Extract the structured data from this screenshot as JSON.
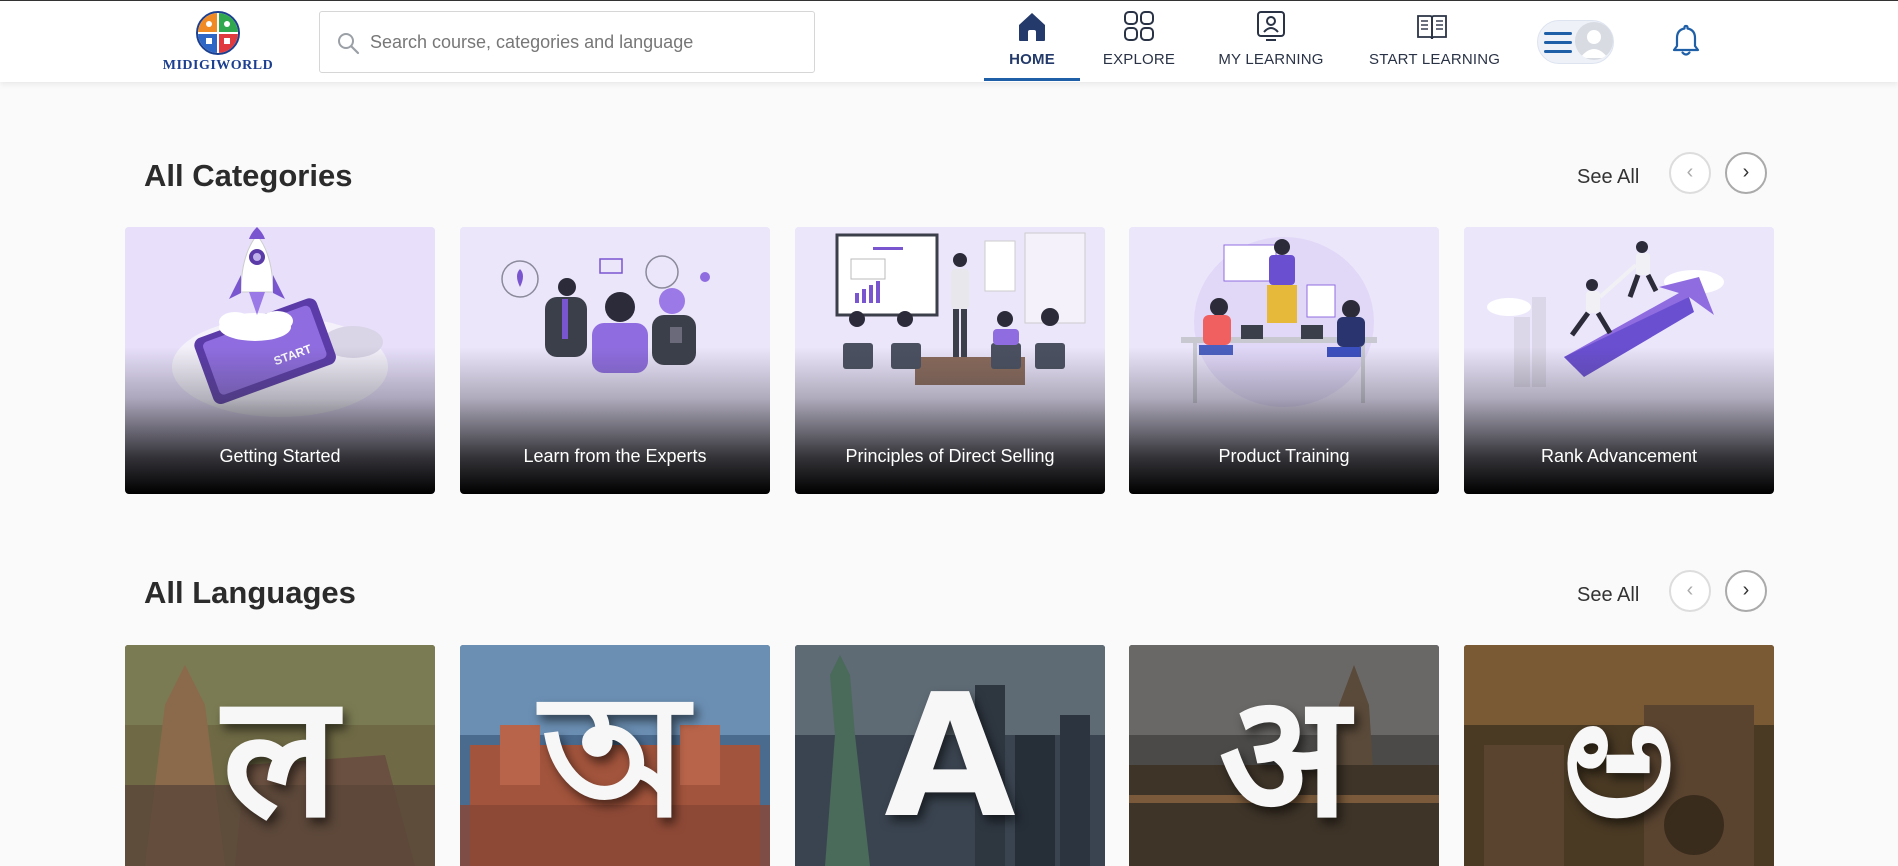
{
  "header": {
    "logo_text": "MIDIGIWORLD",
    "search": {
      "placeholder": "Search course, categories and language",
      "value": ""
    },
    "nav": [
      {
        "label": "HOME",
        "icon": "home-icon",
        "active": true
      },
      {
        "label": "EXPLORE",
        "icon": "grid-icon",
        "active": false
      },
      {
        "label": "MY LEARNING",
        "icon": "monitor-user-icon",
        "active": false
      },
      {
        "label": "START LEARNING",
        "icon": "book-icon",
        "active": false
      }
    ],
    "accent_color": "#1f5fa8"
  },
  "categories": {
    "title": "All Categories",
    "see_all": "See All",
    "prev_icon": "‹",
    "next_icon": "›",
    "items": [
      {
        "label": "Getting Started"
      },
      {
        "label": "Learn from the Experts"
      },
      {
        "label": "Principles of Direct Selling"
      },
      {
        "label": "Product Training"
      },
      {
        "label": "Rank Advancement"
      }
    ]
  },
  "languages": {
    "title": "All Languages",
    "see_all": "See All",
    "prev_icon": "‹",
    "next_icon": "›",
    "items": [
      {
        "glyph": "ल"
      },
      {
        "glyph": "অ"
      },
      {
        "glyph": "A"
      },
      {
        "glyph": "अ"
      },
      {
        "glyph": "ಅ"
      }
    ]
  }
}
